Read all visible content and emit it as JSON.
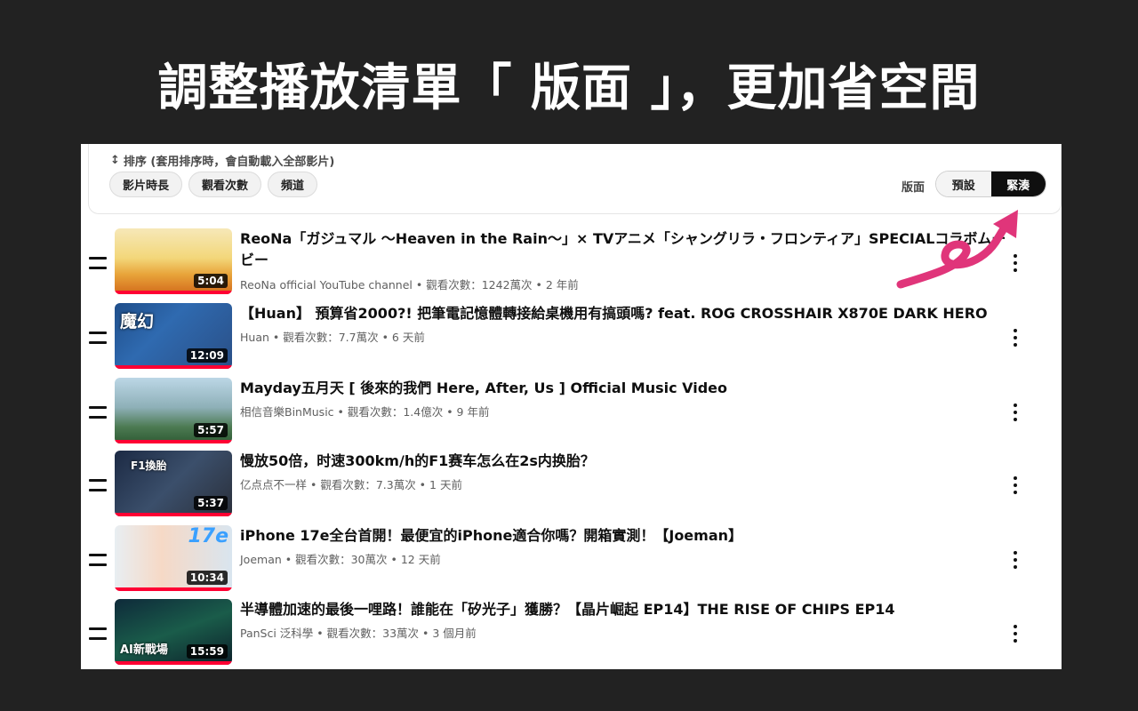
{
  "headline": "調整播放清單「 版面 」，更加省空間",
  "sort": {
    "hint": "排序 (套用排序時，會自動載入全部影片)",
    "icon": "sort-arrows-icon",
    "chips": [
      "影片時長",
      "觀看次數",
      "頻道"
    ]
  },
  "layout": {
    "label": "版面",
    "options": [
      "預設",
      "緊湊"
    ],
    "selected": "緊湊"
  },
  "videos": [
    {
      "title": "ReoNa「ガジュマル 〜Heaven in the Rain〜」× TVアニメ「シャングリラ・フロンティア」SPECIALコラボムービー",
      "channel": "ReoNa official YouTube channel",
      "meta": "ReoNa official YouTube channel • 觀看次數：1242萬次 • 2 年前",
      "duration": "5:04",
      "thumb_text": ""
    },
    {
      "title": "【Huan】 預算省2000?! 把筆電記憶體轉接給桌機用有搞頭嗎? feat. ROG CROSSHAIR X870E DARK HERO",
      "meta": "Huan • 觀看次數：7.7萬次 • 6 天前",
      "duration": "12:09",
      "thumb_text": "魔幻"
    },
    {
      "title": "Mayday五月天 [ 後來的我們 Here, After, Us ] Official Music Video",
      "meta": "相信音樂BinMusic • 觀看次數：1.4億次 • 9 年前",
      "duration": "5:57",
      "thumb_text": ""
    },
    {
      "title": "慢放50倍，时速300km/h的F1赛车怎么在2s内换胎？",
      "meta": "亿点点不一样 • 觀看次數：7.3萬次 • 1 天前",
      "duration": "5:37",
      "thumb_text": "F1換胎"
    },
    {
      "title": "iPhone 17e全台首開！最便宜的iPhone適合你嗎？開箱實測！【Joeman】",
      "meta": "Joeman • 觀看次數：30萬次 • 12 天前",
      "duration": "10:34",
      "thumb_text": "17e"
    },
    {
      "title": "半導體加速的最後一哩路！誰能在「矽光子」獲勝？【晶片崛起 EP14】THE RISE OF CHIPS EP14",
      "meta": "PanSci 泛科學 • 觀看次數：33萬次 • 3 個月前",
      "duration": "15:59",
      "thumb_text": "AI新戰場"
    }
  ],
  "colors": {
    "accent_arrow": "#e0357a",
    "progress": "#ff0033"
  }
}
